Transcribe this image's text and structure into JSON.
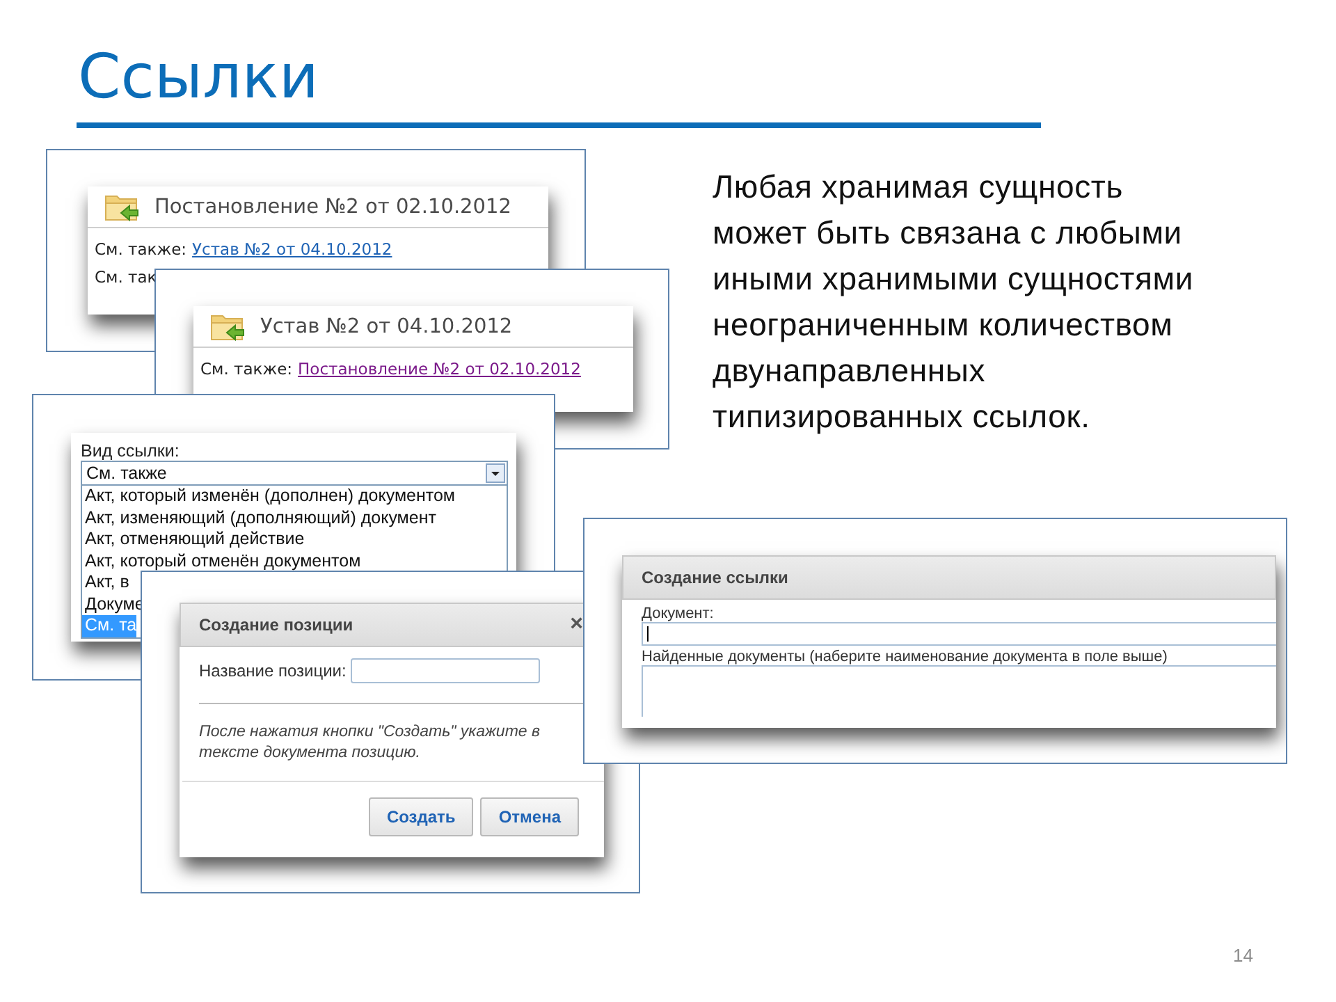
{
  "slide": {
    "title": "Ссылки",
    "text": "Любая хранимая сущность может быть связана с любыми иными хранимыми сущностями неограниченным количеством двунаправленных типизированных ссылок.",
    "page_number": "14"
  },
  "screenshots": [
    {
      "kind": "record",
      "title": "Постановление №2 от 02.10.2012",
      "lines": [
        {
          "label": "См. также:",
          "link": "Устав №2 от 04.10.2012",
          "visited": false
        },
        {
          "label": "См. так"
        }
      ]
    },
    {
      "kind": "record",
      "title": "Устав №2 от 04.10.2012",
      "lines": [
        {
          "label": "См. также:",
          "link": "Постановление №2 от 02.10.2012",
          "visited": true
        }
      ]
    },
    {
      "kind": "link_type",
      "label": "Вид ссылки:",
      "value": "См. также",
      "options": [
        {
          "label": "Акт, который изменён (дополнен) документом",
          "selected": false
        },
        {
          "label": "Акт, изменяющий (дополняющий) документ",
          "selected": false
        },
        {
          "label": "Акт, отменяющий действие",
          "selected": false
        },
        {
          "label": "Акт, который отменён документом",
          "selected": false
        },
        {
          "label": "Акт, в",
          "selected": false
        },
        {
          "label": "Докуме",
          "selected": false
        },
        {
          "label": "См. та",
          "selected": true
        }
      ]
    },
    {
      "kind": "position_dialog",
      "title": "Создание позиции",
      "close": "×",
      "field_label": "Название позиции:",
      "hint": "После нажатия кнопки \"Создать\" укажите в тексте документа позицию.",
      "buttons": [
        "Создать",
        "Отмена"
      ]
    },
    {
      "kind": "link_dialog",
      "title": "Создание ссылки",
      "field_label": "Документ:",
      "list_label": "Найденные документы (наберите наименование документа в поле выше)"
    }
  ]
}
